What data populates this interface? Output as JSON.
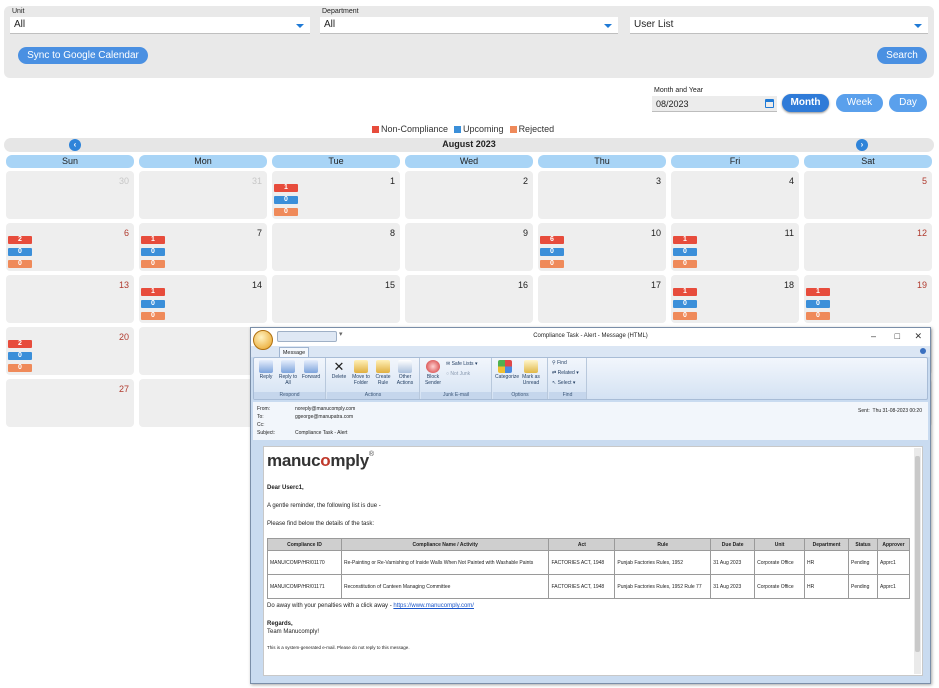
{
  "filters": {
    "unit_label": "Unit",
    "unit_value": "All",
    "department_label": "Department",
    "department_value": "All",
    "userlist_value": "User List",
    "sync_button": "Sync to Google Calendar",
    "search_button": "Search"
  },
  "date_controls": {
    "month_year_label": "Month and Year",
    "month_year_value": "08/2023",
    "views": [
      "Month",
      "Week",
      "Day"
    ],
    "active_view": "Month"
  },
  "legend": [
    {
      "label": "Non-Compliance",
      "color": "#e74c3c"
    },
    {
      "label": "Upcoming",
      "color": "#3b8fd9"
    },
    {
      "label": "Rejected",
      "color": "#ef8a5a"
    }
  ],
  "calendar": {
    "title": "August 2023",
    "weekdays": [
      "Sun",
      "Mon",
      "Tue",
      "Wed",
      "Thu",
      "Fri",
      "Sat"
    ],
    "weeks": [
      [
        {
          "d": "30",
          "muted": true
        },
        {
          "d": "31",
          "muted": true
        },
        {
          "d": "1",
          "c": [
            "1",
            "0",
            "0"
          ]
        },
        {
          "d": "2"
        },
        {
          "d": "3"
        },
        {
          "d": "4"
        },
        {
          "d": "5"
        }
      ],
      [
        {
          "d": "6",
          "c": [
            "2",
            "0",
            "0"
          ]
        },
        {
          "d": "7",
          "c": [
            "1",
            "0",
            "0"
          ]
        },
        {
          "d": "8"
        },
        {
          "d": "9"
        },
        {
          "d": "10",
          "c": [
            "6",
            "0",
            "0"
          ]
        },
        {
          "d": "11",
          "c": [
            "1",
            "0",
            "0"
          ]
        },
        {
          "d": "12"
        }
      ],
      [
        {
          "d": "13"
        },
        {
          "d": "14",
          "c": [
            "1",
            "0",
            "0"
          ]
        },
        {
          "d": "15"
        },
        {
          "d": "16"
        },
        {
          "d": "17"
        },
        {
          "d": "18",
          "c": [
            "1",
            "0",
            "0"
          ]
        },
        {
          "d": "19",
          "c": [
            "1",
            "0",
            "0"
          ]
        }
      ],
      [
        {
          "d": "20",
          "c": [
            "2",
            "0",
            "0"
          ]
        },
        {
          "d": ""
        },
        {
          "d": ""
        },
        {
          "d": ""
        },
        {
          "d": ""
        },
        {
          "d": ""
        },
        {
          "d": ""
        }
      ],
      [
        {
          "d": "27"
        },
        {
          "d": ""
        },
        {
          "d": ""
        },
        {
          "d": ""
        },
        {
          "d": ""
        },
        {
          "d": ""
        },
        {
          "d": ""
        }
      ]
    ]
  },
  "email": {
    "window_title": "Compliance Task - Alert - Message (HTML)",
    "tab": "Message",
    "ribbon": {
      "groups": [
        "Respond",
        "Actions",
        "Junk E-mail",
        "Options",
        "Find"
      ],
      "reply": "Reply",
      "reply_all": "Reply to All",
      "forward": "Forward",
      "delete": "Delete",
      "move_to_folder": "Move to Folder",
      "create_rule": "Create Rule",
      "other_actions": "Other Actions",
      "block_sender": "Block Sender",
      "safe_lists": "Safe Lists",
      "not_junk": "Not Junk",
      "categorize": "Categorize",
      "mark_as_unread": "Mark as Unread",
      "find": "Find",
      "related": "Related",
      "select": "Select"
    },
    "from_label": "From:",
    "from": "noreply@manucomply.com",
    "to_label": "To:",
    "to": "ggeorge@manupatra.com",
    "cc_label": "Cc:",
    "subject_label": "Subject:",
    "subject": "Compliance Task - Alert",
    "sent_label": "Sent:",
    "sent": "Thu 31-08-2023 00:20",
    "brand_a": "manuc",
    "brand_b": "o",
    "brand_c": "mply",
    "brand_reg": "®",
    "greeting": "Dear Userc1,",
    "line1": "A gentle reminder, the following list is due -",
    "line2": "Please find below the details of the task:",
    "table": {
      "headers": [
        "Compliance ID",
        "Compliance Name / Activity",
        "Act",
        "Rule",
        "Due Date",
        "Unit",
        "Department",
        "Status",
        "Approver"
      ],
      "rows": [
        [
          "MANU/COMP/HR/01170",
          "Re-Painting or Re-Varnishing of Inside Walls When Not Painted with Washable Paints",
          "FACTORIES ACT, 1948",
          "Punjab Factories Rules, 1952",
          "31 Aug 2023",
          "Corporate Office",
          "HR",
          "Pending",
          "Apprc1"
        ],
        [
          "MANU/COMP/HR/01171",
          "Reconstitution of Canteen Managing Committee",
          "FACTORIES ACT, 1948",
          "Punjab Factories Rules, 1952 Rule 77",
          "31 Aug 2023",
          "Corporate Office",
          "HR",
          "Pending",
          "Apprc1"
        ]
      ]
    },
    "penalty_text": "Do away with your penalties with a click away - ",
    "penalty_link": "https://www.manucomply.com/",
    "regards": "Regards,",
    "team": "Team Manucomply!",
    "footer": "This is a system-generated e-mail. Please do not reply to this message."
  }
}
